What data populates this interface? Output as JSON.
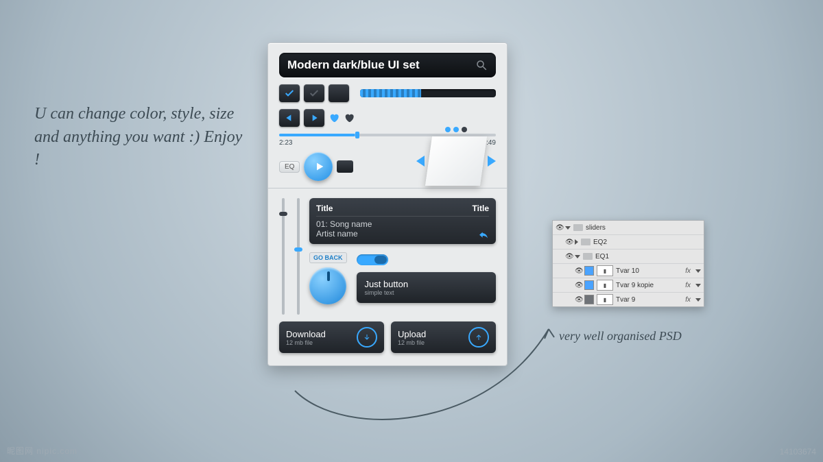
{
  "annotation_left": "U can change color, style, size and anything you want :) Enjoy !",
  "annotation_right": "very well organised PSD",
  "search": {
    "title": "Modern dark/blue UI set"
  },
  "seek": {
    "current": "2:23",
    "total": "7:49"
  },
  "eq_label": "EQ",
  "song": {
    "head_left": "Title",
    "head_right": "Title",
    "line1": "01: Song name",
    "line2": "Artist name"
  },
  "go_back": "GO BACK",
  "just_button": {
    "title": "Just button",
    "sub": "simple text"
  },
  "download": {
    "title": "Download",
    "sub": "12 mb file"
  },
  "upload": {
    "title": "Upload",
    "sub": "12 mb file"
  },
  "layers": {
    "root": "sliders",
    "g1": "EQ2",
    "g2": "EQ1",
    "i1": "Tvar 10",
    "i2": "Tvar 9 kopie",
    "i3": "Tvar 9",
    "fx": "fx"
  },
  "watermark": "昵图网 nipic.com",
  "image_id": "14103674"
}
